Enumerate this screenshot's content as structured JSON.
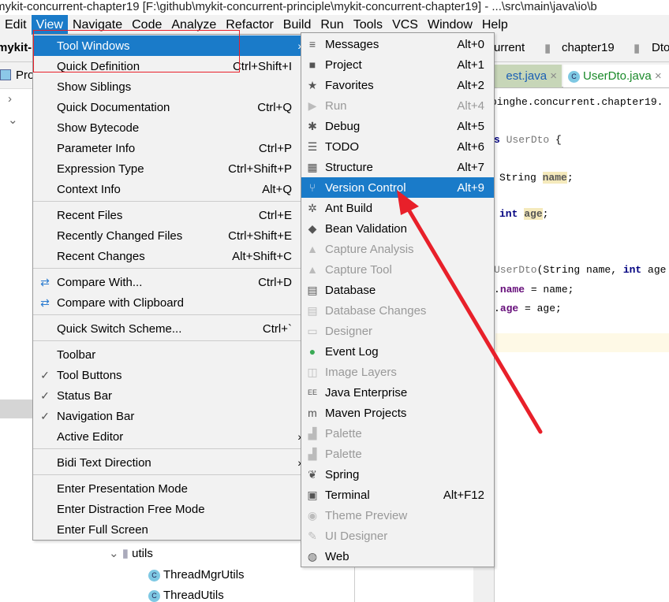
{
  "window": {
    "title": "mykit-concurrent-chapter19 [F:\\github\\mykit-concurrent-principle\\mykit-concurrent-chapter19] - ...\\src\\main\\java\\io\\b"
  },
  "menubar": [
    "Edit",
    "View",
    "Navigate",
    "Code",
    "Analyze",
    "Refactor",
    "Build",
    "Run",
    "Tools",
    "VCS",
    "Window",
    "Help"
  ],
  "navbar": {
    "project": "mykit-",
    "crumbs": [
      "urrent",
      "chapter19",
      "Dto"
    ]
  },
  "project_panel": {
    "title": "Pro",
    "tree": [
      {
        "name": "utils",
        "type": "folder"
      },
      {
        "name": "ThreadMgrUtils",
        "type": "class"
      },
      {
        "name": "ThreadUtils",
        "type": "class"
      }
    ]
  },
  "tabs": [
    {
      "label": "est.java",
      "active": false
    },
    {
      "label": "UserDto.java",
      "active": true
    }
  ],
  "editor": {
    "lines": [
      "pinghe.concurrent.chapter19.",
      "s UserDto {",
      "String name;",
      "int age;",
      "UserDto(String name, int age",
      ". name = name;",
      ". age = age;"
    ]
  },
  "view_menu": {
    "groups": [
      [
        {
          "label": "Tool Windows",
          "submenu": true,
          "selected": true
        },
        {
          "label": "Quick Definition",
          "shortcut": "Ctrl+Shift+I"
        },
        {
          "label": "Show Siblings"
        },
        {
          "label": "Quick Documentation",
          "shortcut": "Ctrl+Q"
        },
        {
          "label": "Show Bytecode"
        },
        {
          "label": "Parameter Info",
          "shortcut": "Ctrl+P"
        },
        {
          "label": "Expression Type",
          "shortcut": "Ctrl+Shift+P"
        },
        {
          "label": "Context Info",
          "shortcut": "Alt+Q"
        }
      ],
      [
        {
          "label": "Recent Files",
          "shortcut": "Ctrl+E"
        },
        {
          "label": "Recently Changed Files",
          "shortcut": "Ctrl+Shift+E"
        },
        {
          "label": "Recent Changes",
          "shortcut": "Alt+Shift+C"
        }
      ],
      [
        {
          "label": "Compare With...",
          "shortcut": "Ctrl+D",
          "icon": "compare-icon"
        },
        {
          "label": "Compare with Clipboard",
          "icon": "compare-icon"
        }
      ],
      [
        {
          "label": "Quick Switch Scheme...",
          "shortcut": "Ctrl+`"
        }
      ],
      [
        {
          "label": "Toolbar"
        },
        {
          "label": "Tool Buttons",
          "checked": true
        },
        {
          "label": "Status Bar",
          "checked": true
        },
        {
          "label": "Navigation Bar",
          "checked": true
        },
        {
          "label": "Active Editor",
          "submenu": true
        }
      ],
      [
        {
          "label": "Bidi Text Direction",
          "submenu": true
        }
      ],
      [
        {
          "label": "Enter Presentation Mode"
        },
        {
          "label": "Enter Distraction Free Mode"
        },
        {
          "label": "Enter Full Screen"
        }
      ]
    ]
  },
  "tool_windows_menu": [
    {
      "label": "Messages",
      "shortcut": "Alt+0",
      "icon": "messages-icon",
      "glyph": "≡"
    },
    {
      "label": "Project",
      "shortcut": "Alt+1",
      "icon": "folder-icon",
      "glyph": "■"
    },
    {
      "label": "Favorites",
      "shortcut": "Alt+2",
      "icon": "star-icon",
      "glyph": "★"
    },
    {
      "label": "Run",
      "shortcut": "Alt+4",
      "icon": "run-icon",
      "glyph": "▶",
      "disabled": true
    },
    {
      "label": "Debug",
      "shortcut": "Alt+5",
      "icon": "bug-icon",
      "glyph": "✱"
    },
    {
      "label": "TODO",
      "shortcut": "Alt+6",
      "icon": "todo-icon",
      "glyph": "☰"
    },
    {
      "label": "Structure",
      "shortcut": "Alt+7",
      "icon": "structure-icon",
      "glyph": "▦"
    },
    {
      "label": "Version Control",
      "shortcut": "Alt+9",
      "icon": "vcs-icon",
      "glyph": "⑂",
      "selected": true
    },
    {
      "label": "Ant Build",
      "icon": "ant-icon",
      "glyph": "✲"
    },
    {
      "label": "Bean Validation",
      "icon": "bean-icon",
      "glyph": "◆"
    },
    {
      "label": "Capture Analysis",
      "icon": "capture-icon",
      "glyph": "▲",
      "disabled": true
    },
    {
      "label": "Capture Tool",
      "icon": "capture-icon",
      "glyph": "▲",
      "disabled": true
    },
    {
      "label": "Database",
      "icon": "database-icon",
      "glyph": "▤"
    },
    {
      "label": "Database Changes",
      "icon": "database-icon",
      "glyph": "▤",
      "disabled": true
    },
    {
      "label": "Designer",
      "icon": "designer-icon",
      "glyph": "▭",
      "disabled": true
    },
    {
      "label": "Event Log",
      "icon": "event-log-icon",
      "glyph": "●"
    },
    {
      "label": "Image Layers",
      "icon": "layers-icon",
      "glyph": "◫",
      "disabled": true
    },
    {
      "label": "Java Enterprise",
      "icon": "java-ee-icon",
      "glyph": "EE"
    },
    {
      "label": "Maven Projects",
      "icon": "maven-icon",
      "glyph": "m"
    },
    {
      "label": "Palette",
      "icon": "palette-icon",
      "glyph": "▟",
      "disabled": true
    },
    {
      "label": "Palette",
      "icon": "palette-icon",
      "glyph": "▟",
      "disabled": true
    },
    {
      "label": "Spring",
      "icon": "spring-icon",
      "glyph": "❦"
    },
    {
      "label": "Terminal",
      "shortcut": "Alt+F12",
      "icon": "terminal-icon",
      "glyph": "▣"
    },
    {
      "label": "Theme Preview",
      "icon": "theme-icon",
      "glyph": "◉",
      "disabled": true
    },
    {
      "label": "UI Designer",
      "icon": "ui-designer-icon",
      "glyph": "✎",
      "disabled": true
    },
    {
      "label": "Web",
      "icon": "globe-icon",
      "glyph": "◍"
    }
  ],
  "colors": {
    "selection": "#1a7bc9",
    "annotation": "#e8202a"
  }
}
